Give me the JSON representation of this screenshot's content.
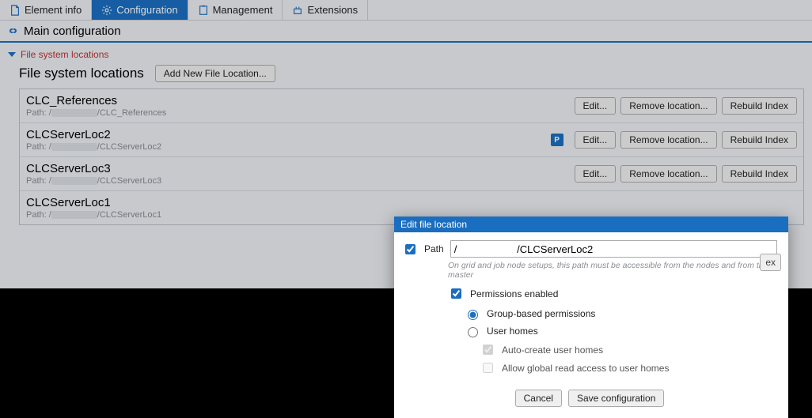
{
  "tabs": {
    "element_info": "Element info",
    "configuration": "Configuration",
    "management": "Management",
    "extensions": "Extensions"
  },
  "subheader": "Main configuration",
  "collapser": "File system locations",
  "section_title": "File system locations",
  "add_button": "Add New File Location...",
  "path_prefix": "Path: /",
  "locations": [
    {
      "name": "CLC_References",
      "suffix": "/CLC_References",
      "badge": "",
      "edit": "Edit...",
      "remove": "Remove location...",
      "rebuild": "Rebuild Index"
    },
    {
      "name": "CLCServerLoc2",
      "suffix": "/CLCServerLoc2",
      "badge": "P",
      "edit": "Edit...",
      "remove": "Remove location...",
      "rebuild": "Rebuild Index"
    },
    {
      "name": "CLCServerLoc3",
      "suffix": "/CLCServerLoc3",
      "badge": "",
      "edit": "Edit...",
      "remove": "Remove location...",
      "rebuild": "Rebuild Index"
    },
    {
      "name": "CLCServerLoc1",
      "suffix": "/CLCServerLoc1",
      "badge": "",
      "edit": "",
      "remove": "",
      "rebuild": "ex"
    }
  ],
  "dialog": {
    "title": "Edit file location",
    "path_label": "Path",
    "path_value": "/                     /CLCServerLoc2",
    "hint": "On grid and job node setups, this path must be accessible from the nodes and from the master",
    "permissions_enabled": "Permissions enabled",
    "group_based": "Group-based permissions",
    "user_homes": "User homes",
    "auto_create": "Auto-create user homes",
    "allow_global": "Allow global read access to user homes",
    "cancel": "Cancel",
    "save": "Save configuration"
  }
}
